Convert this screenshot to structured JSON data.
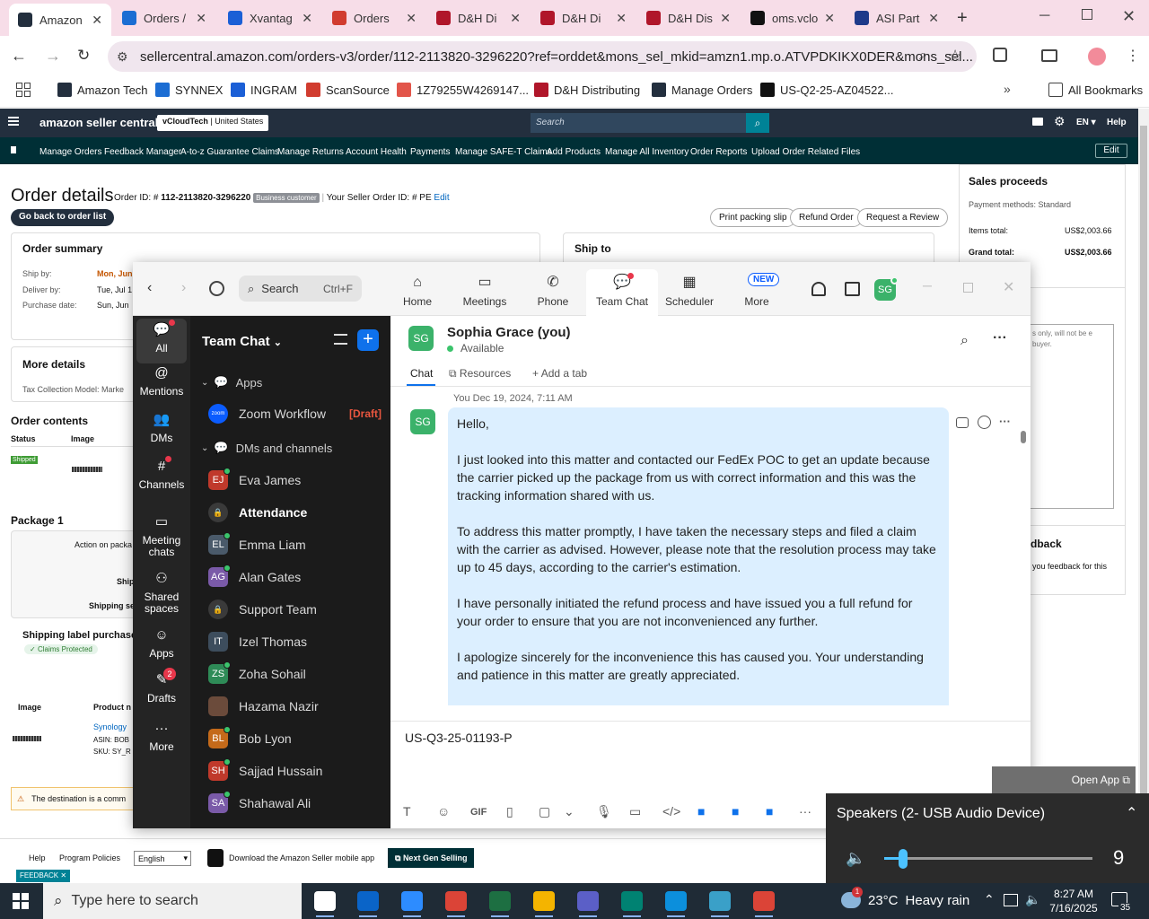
{
  "browser": {
    "tabs": [
      {
        "title": "Amazon",
        "icon": "amazon-icon",
        "color": "#232f3e",
        "active": true
      },
      {
        "title": "Orders / ",
        "icon": "synnex-icon",
        "color": "#1b6dd3"
      },
      {
        "title": "Xvantag",
        "icon": "ingram-icon",
        "color": "#1b5fd6"
      },
      {
        "title": "Orders",
        "icon": "scansource-icon",
        "color": "#d13c2f"
      },
      {
        "title": "D&H Di",
        "icon": "dh-icon",
        "color": "#b0162a"
      },
      {
        "title": "D&H Di",
        "icon": "dh-icon",
        "color": "#b0162a"
      },
      {
        "title": "D&H Dis",
        "icon": "dh-icon",
        "color": "#b0162a"
      },
      {
        "title": "oms.vclo",
        "icon": "oms-icon",
        "color": "#111"
      },
      {
        "title": "ASI Part",
        "icon": "asi-icon",
        "color": "#1e3a8a"
      }
    ],
    "url": "sellercentral.amazon.com/orders-v3/order/112-2113820-3296220?ref=orddet&mons_sel_mkid=amzn1.mp.o.ATVPDKIKX0DER&mons_sel...",
    "bookmarks": [
      {
        "label": "Amazon Tech",
        "color": "#232f3e"
      },
      {
        "label": "SYNNEX",
        "color": "#1b6dd3"
      },
      {
        "label": "INGRAM",
        "color": "#1b5fd6"
      },
      {
        "label": "ScanSource",
        "color": "#d13c2f"
      },
      {
        "label": "1Z79255W4269147...",
        "color": "#e2554a"
      },
      {
        "label": "D&H Distributing",
        "color": "#b0162a"
      },
      {
        "label": "Manage Orders",
        "color": "#232f3e"
      },
      {
        "label": "US-Q2-25-AZ04522...",
        "color": "#111"
      }
    ],
    "all_bookmarks": "All Bookmarks"
  },
  "seller": {
    "logo": "amazon seller central",
    "store": "vCloudTech",
    "region": "United States",
    "search_placeholder": "Search",
    "lang": "EN",
    "help": "Help",
    "nav": [
      "Manage Orders",
      "Feedback Manager",
      "A-to-z Guarantee Claims",
      "Manage Returns",
      "Account Health",
      "Payments",
      "Manage SAFE-T Claims",
      "Add Products",
      "Manage All Inventory",
      "Order Reports",
      "Upload Order Related Files"
    ],
    "edit": "Edit",
    "order_title": "Order details",
    "order_id_label": "Order ID: #",
    "order_id": "112-2113820-3296220",
    "business_badge": "Business customer",
    "seller_order_id": "Your Seller Order ID: # PE",
    "edit_link": "Edit",
    "back_btn": "Go back to order list",
    "print_btn": "Print packing slip",
    "refund_btn": "Refund Order",
    "review_btn": "Request a Review",
    "summary_title": "Order summary",
    "ship_by_label": "Ship by:",
    "ship_by_val": "Mon, Jun",
    "deliver_by_label": "Deliver by:",
    "deliver_by_val": "Tue, Jul 1",
    "purchase_label": "Purchase date:",
    "purchase_val": "Sun, Jun",
    "ship_to": "Ship to",
    "more_details": "More details",
    "tax_model": "Tax Collection Model: Marke",
    "contents": "Order contents",
    "col_status": "Status",
    "col_image": "Image",
    "shipped": "Shipped",
    "package": "Package 1",
    "action_text": "Action on packa",
    "ship_short": "Ship",
    "shipping_short": "Shipping se",
    "label_purchase": "Shipping label purchase",
    "claims": "Claims Protected",
    "img_col": "Image",
    "product_col": "Product n",
    "product_name": "Synology",
    "asin": "ASIN: BOB",
    "sku": "SKU: SY_R",
    "warning": "The destination is a comm",
    "sales_title": "Sales proceeds",
    "payment_methods": "Payment methods: Standard",
    "items_total_label": "Items total:",
    "items_total": "US$2,003.66",
    "grand_total_label": "Grand total:",
    "grand_total": "US$2,003.66",
    "note_text": "s only, will not be e buyer.",
    "feedback_title": "dback",
    "feedback_text": "you feedback for this",
    "footer_help": "Help",
    "footer_policies": "Program Policies",
    "footer_lang": "English",
    "footer_app": "Download the Amazon Seller mobile app",
    "footer_next": "Next Gen Selling",
    "feedback_tab": "FEEDBACK"
  },
  "zoom": {
    "search": "Search",
    "search_shortcut": "Ctrl+F",
    "nav": [
      {
        "label": "Home",
        "icon": "home-icon"
      },
      {
        "label": "Meetings",
        "icon": "video-icon"
      },
      {
        "label": "Phone",
        "icon": "phone-icon"
      },
      {
        "label": "Team Chat",
        "icon": "chat-icon",
        "active": true
      },
      {
        "label": "Scheduler",
        "icon": "calendar-icon"
      },
      {
        "label": "More",
        "icon": "more-icon"
      }
    ],
    "new_badge": "NEW",
    "user_initials": "SG",
    "rail": [
      {
        "label": "All",
        "icon": "chat-bubble-icon"
      },
      {
        "label": "Mentions",
        "icon": "at-icon"
      },
      {
        "label": "DMs",
        "icon": "users-icon"
      },
      {
        "label": "Channels",
        "icon": "hash-icon"
      },
      {
        "label": "Meeting\nchats",
        "icon": "meeting-chat-icon"
      },
      {
        "label": "Shared\nspaces",
        "icon": "shared-icon"
      },
      {
        "label": "Apps",
        "icon": "apps-icon"
      },
      {
        "label": "Drafts",
        "icon": "drafts-icon",
        "badge": "2"
      },
      {
        "label": "More",
        "icon": "more-dots-icon"
      }
    ],
    "list_title": "Team Chat",
    "section_apps": "Apps",
    "section_dms": "DMs and channels",
    "workflow": "Zoom Workflow",
    "draft_tag": "[Draft]",
    "contacts": [
      {
        "name": "Eva James",
        "initials": "EJ",
        "color": "#c0392b",
        "online": true
      },
      {
        "name": "Attendance",
        "initials": "",
        "color": "#3a3a3a",
        "lock": true,
        "bold": true
      },
      {
        "name": "Emma Liam",
        "initials": "EL",
        "color": "#4a5a6a",
        "online": true
      },
      {
        "name": "Alan Gates",
        "initials": "AG",
        "color": "#7a5aa8",
        "online": true
      },
      {
        "name": "Support Team",
        "initials": "",
        "color": "#3a3a3a",
        "lock": true
      },
      {
        "name": "Izel Thomas",
        "initials": "IT",
        "color": "#3d4d5d",
        "online": false
      },
      {
        "name": "Zoha Sohail",
        "initials": "ZS",
        "color": "#2e8b57",
        "online": true
      },
      {
        "name": "Hazama Nazir",
        "initials": "",
        "color": "#6b4b3b",
        "online": false
      },
      {
        "name": "Bob Lyon",
        "initials": "BL",
        "color": "#c46a1a",
        "online": true
      },
      {
        "name": "Sajjad Hussain",
        "initials": "SH",
        "color": "#c0392b",
        "online": true
      },
      {
        "name": "Shahawal Ali",
        "initials": "SA",
        "color": "#7a5aa8",
        "online": true
      }
    ],
    "chat_name": "Sophia Grace (you)",
    "status": "Available",
    "tab_chat": "Chat",
    "tab_resources": "Resources",
    "tab_add": "Add a tab",
    "msg_meta": "You Dec 19, 2024, 7:11 AM",
    "msg": [
      "Hello,",
      "I just looked into this matter and contacted our FedEx POC to get an update because the carrier picked up the package from us with correct information and this was the tracking information shared with us.",
      "To address this matter promptly, I have taken the necessary steps and filed a claim with the carrier as advised. However, please note that the resolution process may take up to 45 days, according to the carrier's estimation.",
      "I have personally initiated the refund process and have issued you a full refund for your order to ensure that you are not inconvenienced any further.",
      "I apologize sincerely for the inconvenience this has caused you. Your understanding and patience in this matter are greatly appreciated."
    ],
    "compose_text": "US-Q3-25-01193-P",
    "gif": "GIF"
  },
  "open_app": "Open App",
  "volume": {
    "device": "Speakers (2- USB Audio Device)",
    "level": 9
  },
  "taskbar": {
    "search": "Type here to search",
    "temp": "23°C",
    "weather": "Heavy rain",
    "weather_badge": "1",
    "time": "8:27 AM",
    "date": "7/16/2025",
    "notif": "35"
  }
}
